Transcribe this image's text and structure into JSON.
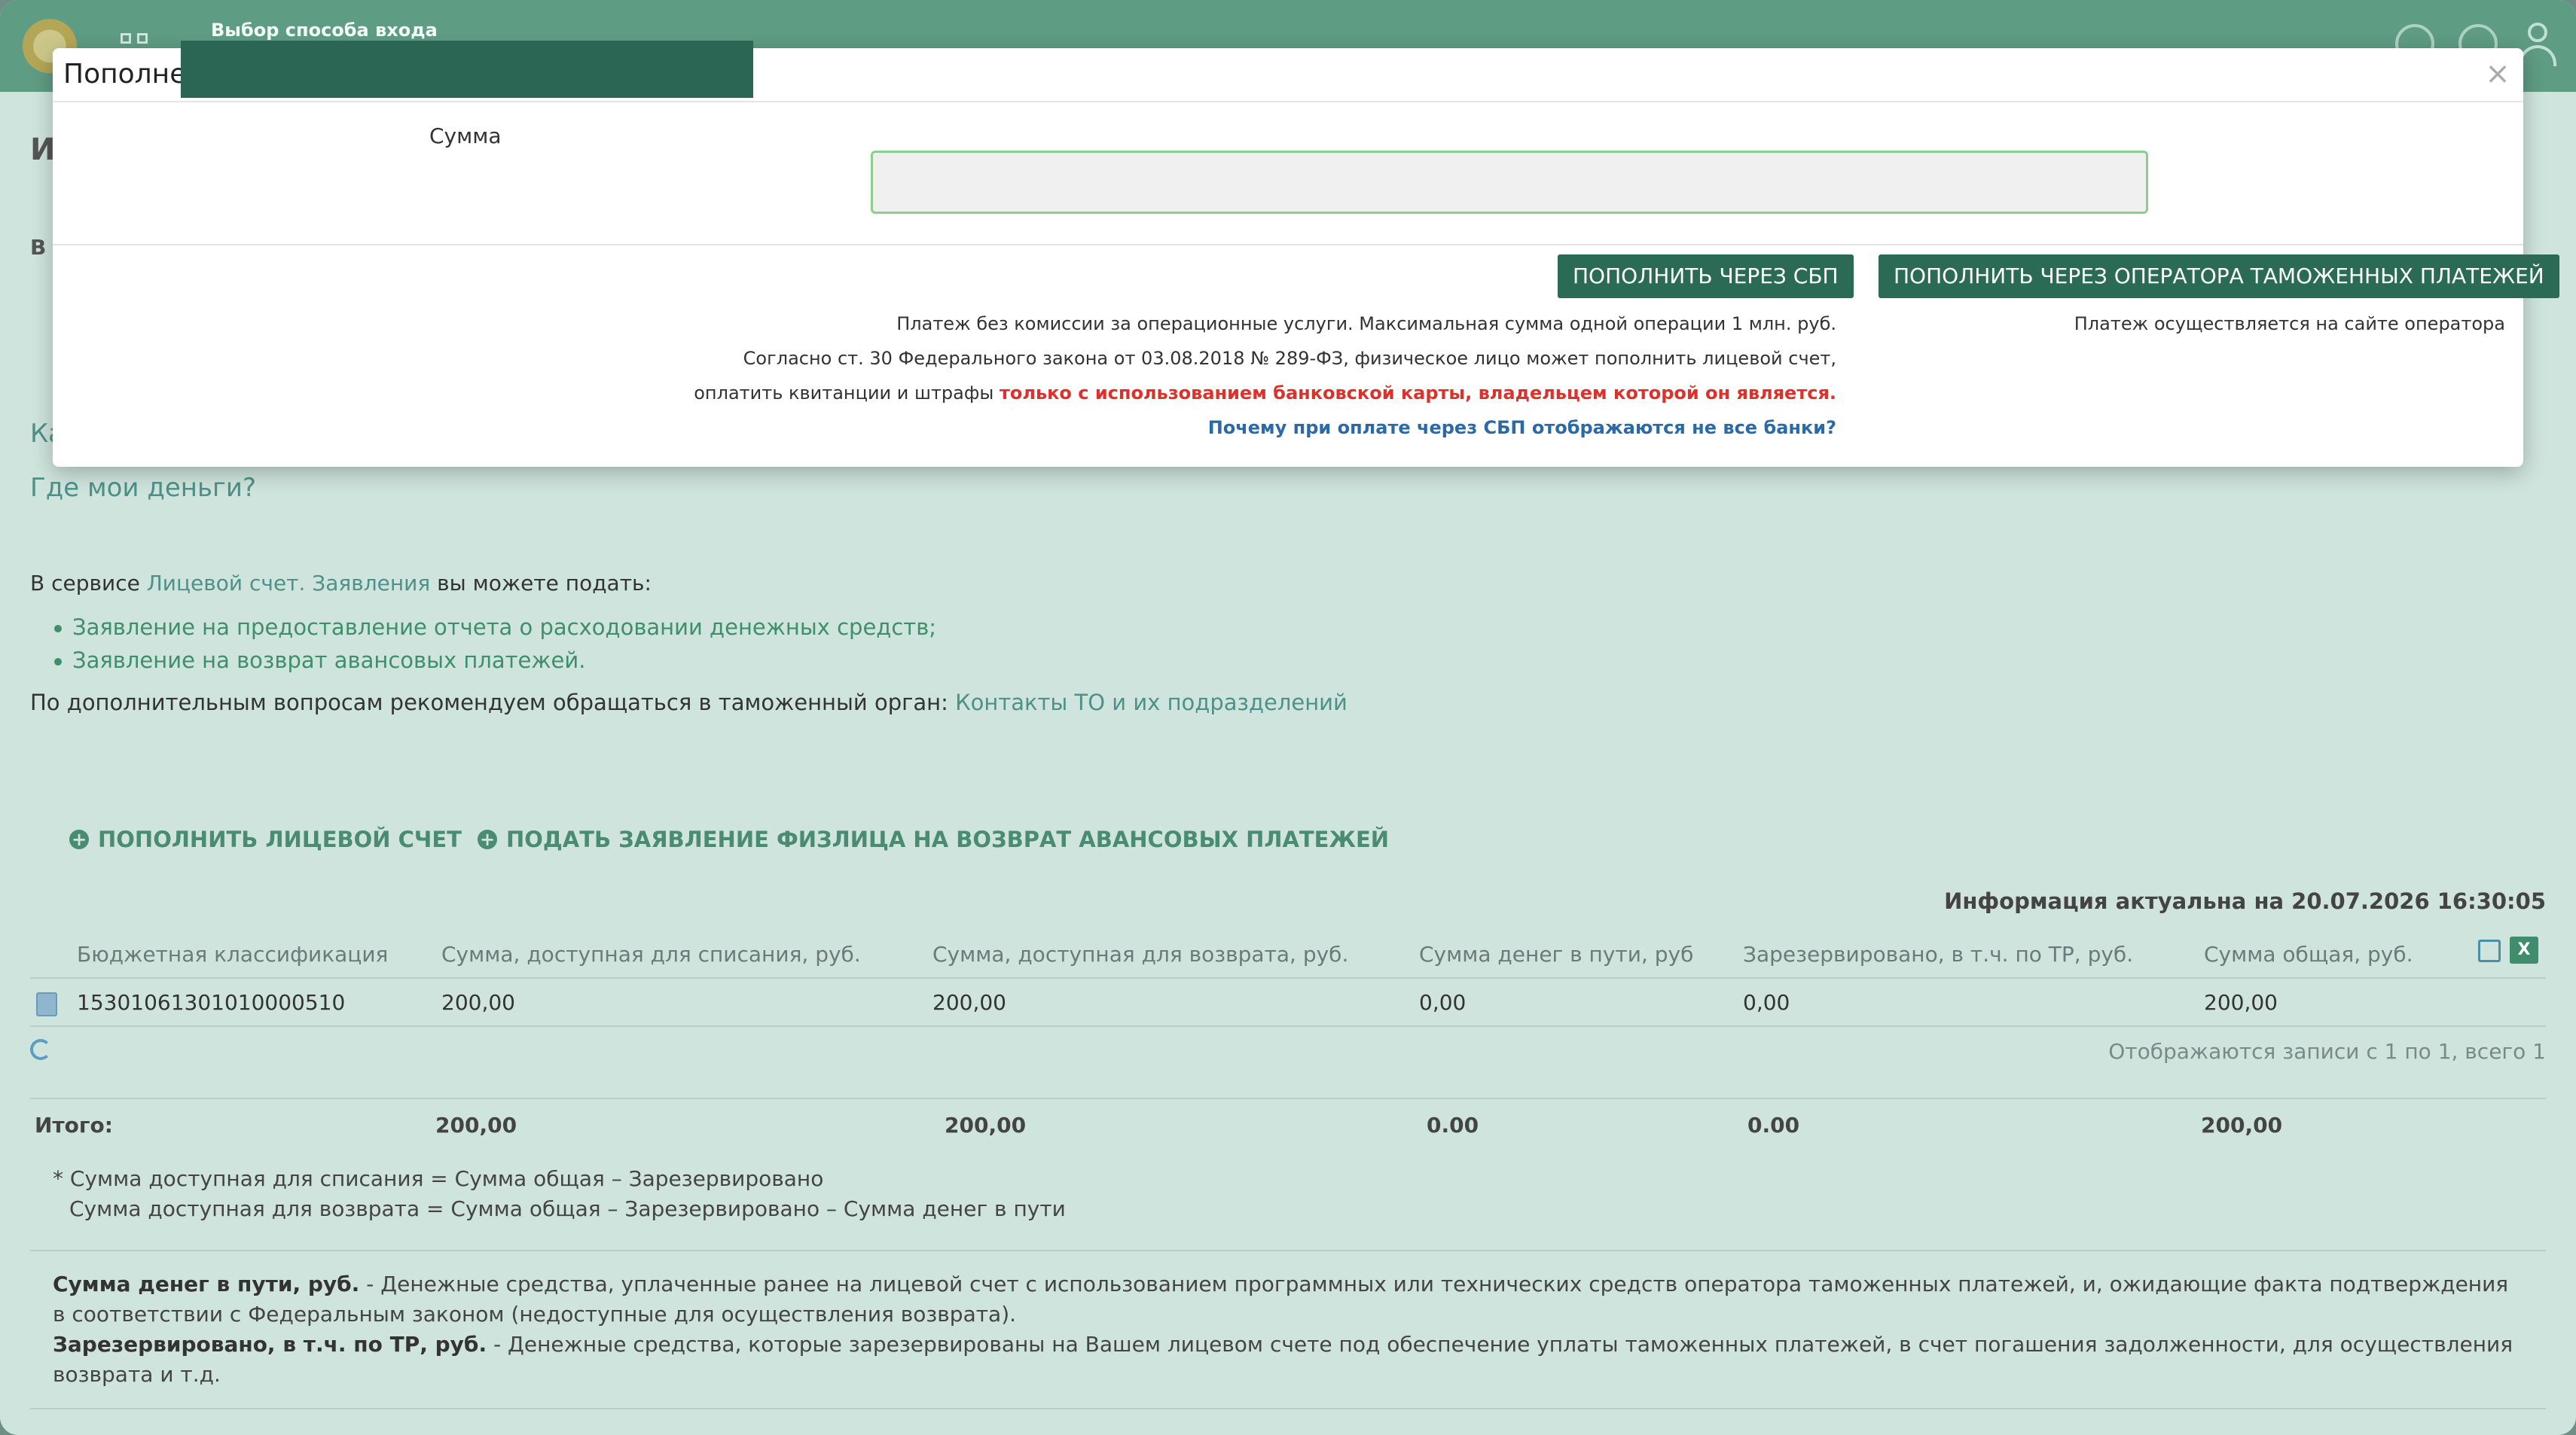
{
  "topbar": {
    "title": "Выбор способа входа"
  },
  "page": {
    "partial_heading": "И",
    "partial_text": "В",
    "partial_link": "Ка",
    "where_money_link": "Где мои деньги?",
    "service_prefix": "В сервисе ",
    "service_link": "Лицевой счет. Заявления",
    "service_suffix": " вы можете подать:",
    "bullets": [
      "Заявление на предоставление отчета о расходовании денежных средств;",
      "Заявление на возврат авансовых платежей."
    ],
    "contacts_prefix": "По дополнительным вопросам рекомендуем обращаться в таможенный орган: ",
    "contacts_link": "Контакты ТО и их подразделений",
    "action_topup": "ПОПОЛНИТЬ ЛИЦЕВОЙ СЧЕТ",
    "action_refund": "ПОДАТЬ ЗАЯВЛЕНИЕ ФИЗЛИЦА НА ВОЗВРАТ АВАНСОВЫХ ПЛАТЕЖЕЙ",
    "actual_info_prefix": "Информация актуальна на ",
    "actual_info_date": "20.07.2026 16:30:05"
  },
  "table": {
    "headers": [
      "Бюджетная классификация",
      "Сумма, доступная для списания, руб.",
      "Сумма, доступная для возврата, руб.",
      "Сумма денег в пути, руб",
      "Зарезервировано, в т.ч. по ТР, руб.",
      "Сумма общая, руб."
    ],
    "rows": [
      [
        "15301061301010000510",
        "200,00",
        "200,00",
        "0,00",
        "0,00",
        "200,00"
      ]
    ],
    "excel_label": "X",
    "pager": "Отображаются записи с 1 по 1, всего 1",
    "totals_label": "Итого:",
    "totals": [
      "200,00",
      "200,00",
      "0.00",
      "0.00",
      "200,00"
    ]
  },
  "notes": [
    "* Сумма доступная для списания = Сумма общая – Зарезервировано",
    "Сумма доступная для возврата = Сумма общая – Зарезервировано – Сумма денег в пути"
  ],
  "legend": {
    "transit_term": "Сумма денег в пути, руб.",
    "transit_desc": " - Денежные средства, уплаченные ранее на лицевой счет с использованием программных или технических средств оператора таможенных платежей, и, ожидающие факта подтверждения в соответствии с Федеральным законом (недоступные для осуществления возврата).",
    "reserved_term": "Зарезервировано, в т.ч. по ТР, руб.",
    "reserved_desc": " - Денежные средства, которые зарезервированы на Вашем лицевом счете под обеспечение уплаты таможенных платежей, в счет погашения задолженности, для осуществления возврата и т.д."
  },
  "modal": {
    "title": "Пополне",
    "close": "×",
    "sum_label": "Сумма",
    "sum_value": "",
    "sum_placeholder": "",
    "btn_sbp": "ПОПОЛНИТЬ ЧЕРЕЗ СБП",
    "btn_operator": "ПОПОЛНИТЬ ЧЕРЕЗ ОПЕРАТОРА ТАМОЖЕННЫХ ПЛАТЕЖЕЙ",
    "info_line1": "Платеж без комиссии за операционные услуги. Максимальная сумма одной операции 1 млн. руб.",
    "info_line2": "Согласно ст. 30 Федерального закона от 03.08.2018 № 289-ФЗ, физическое лицо может пополнить лицевой счет,",
    "info_line3_prefix": "оплатить квитанции и штрафы ",
    "info_line3_warn": "только с использованием банковской карты, владельцем которой он является.",
    "info_faq": "Почему при оплате через СБП отображаются не все банки?",
    "operator_note": "Платеж осуществляется на сайте оператора"
  },
  "colors": {
    "brand_dark": "#2b6b55",
    "topbar": "#5f9c84",
    "page_bg": "#cfe4dd",
    "warning": "#e0302b",
    "link_blue": "#2b6aa8"
  }
}
